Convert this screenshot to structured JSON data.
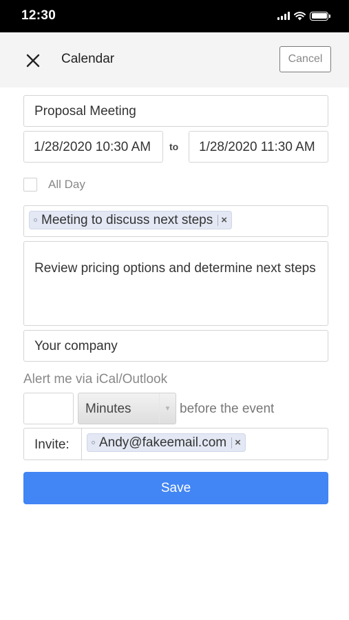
{
  "status_bar": {
    "time": "12:30"
  },
  "header": {
    "title": "Calendar",
    "cancel_label": "Cancel"
  },
  "form": {
    "title": "Proposal Meeting",
    "start_date": "1/28/2020 10:30 AM",
    "to_label": "to",
    "end_date": "1/28/2020 11:30 AM",
    "all_day_label": "All Day",
    "all_day_checked": false,
    "subject_tags": [
      {
        "label": "Meeting to discuss next steps"
      }
    ],
    "description": "Review pricing options and determine next steps",
    "location": "Your company",
    "alert_label": "Alert me via iCal/Outlook",
    "alert_amount": "",
    "alert_unit": "Minutes",
    "alert_suffix": "before the event",
    "invite_label": "Invite:",
    "invite_tags": [
      {
        "label": "Andy@fakeemail.com"
      }
    ],
    "save_label": "Save"
  },
  "icons": {
    "close": "close-icon",
    "signal": "cellular-signal-icon",
    "wifi": "wifi-icon",
    "battery": "battery-icon",
    "tag_remove": "remove-tag-icon",
    "dropdown": "chevron-down-icon"
  },
  "colors": {
    "accent": "#4285f4",
    "tag_bg": "#e3e8f4",
    "header_bg": "#f4f4f4",
    "status_bar_bg": "#000000"
  }
}
